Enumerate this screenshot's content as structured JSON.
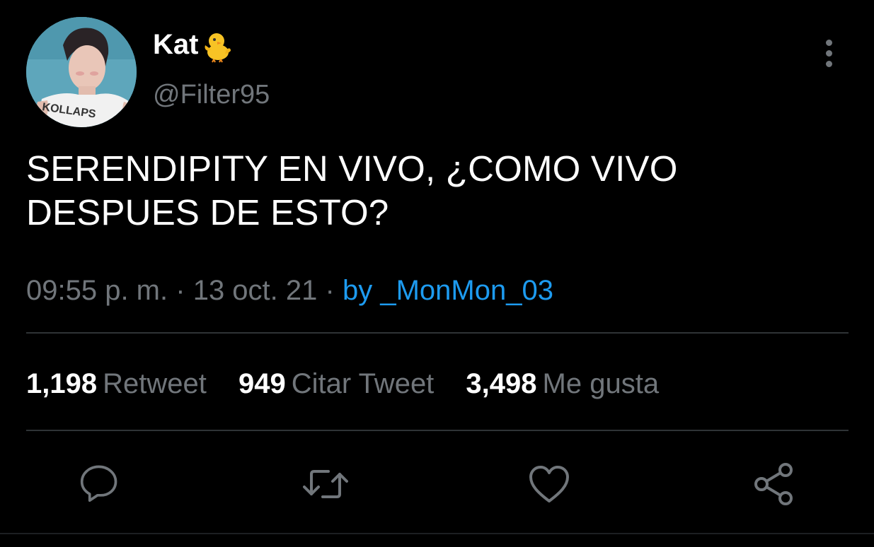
{
  "author": {
    "display_name": "Kat",
    "emoji": "chick-icon",
    "handle": "@Filter95",
    "avatar_text": "KOLLAPS"
  },
  "tweet": {
    "text": "SERENDIPITY EN VIVO, ¿COMO VIVO DESPUES DE ESTO?",
    "time": "09:55 p. m.",
    "separator": "·",
    "date": "13 oct. 21",
    "source": "by _MonMon_03"
  },
  "stats": [
    {
      "count": "1,198",
      "label": "Retweet"
    },
    {
      "count": "949",
      "label": "Citar Tweet"
    },
    {
      "count": "3,498",
      "label": "Me gusta"
    }
  ],
  "actions": [
    "reply-icon",
    "retweet-icon",
    "like-icon",
    "share-icon"
  ],
  "colors": {
    "background": "#000000",
    "text": "#ffffff",
    "secondary": "#71767b",
    "link": "#1d9bf0",
    "divider": "#2f3336"
  }
}
